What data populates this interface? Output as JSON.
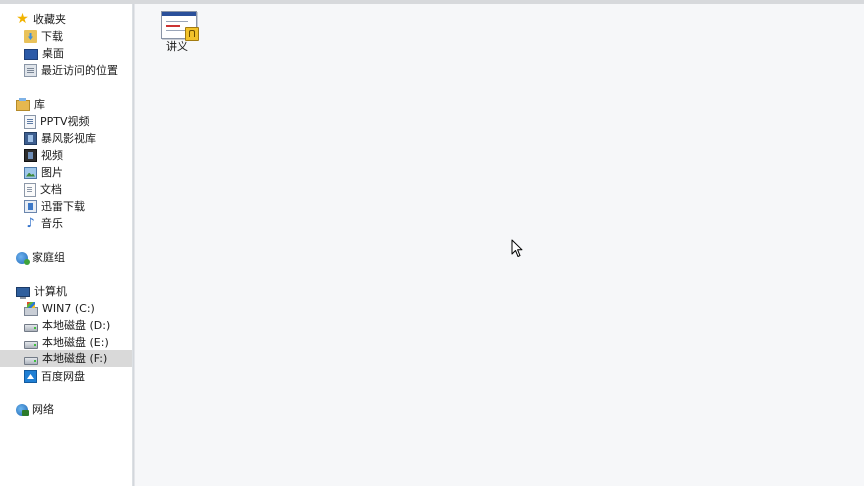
{
  "nav": {
    "favorites": {
      "label": "收藏夹",
      "items": [
        {
          "label": "下载",
          "icon": "download-folder-icon"
        },
        {
          "label": "桌面",
          "icon": "desktop-icon"
        },
        {
          "label": "最近访问的位置",
          "icon": "recent-places-icon"
        }
      ]
    },
    "libraries": {
      "label": "库",
      "items": [
        {
          "label": "PPTV视频",
          "icon": "pptv-library-icon"
        },
        {
          "label": "暴风影视库",
          "icon": "storm-library-icon"
        },
        {
          "label": "视频",
          "icon": "video-library-icon"
        },
        {
          "label": "图片",
          "icon": "pictures-library-icon"
        },
        {
          "label": "文档",
          "icon": "documents-library-icon"
        },
        {
          "label": "迅雷下载",
          "icon": "xunlei-download-icon"
        },
        {
          "label": "音乐",
          "icon": "music-library-icon"
        }
      ]
    },
    "homegroup": {
      "label": "家庭组",
      "icon": "homegroup-icon"
    },
    "computer": {
      "label": "计算机",
      "items": [
        {
          "label": "WIN7 (C:)",
          "icon": "windows-drive-icon"
        },
        {
          "label": "本地磁盘 (D:)",
          "icon": "local-disk-icon"
        },
        {
          "label": "本地磁盘 (E:)",
          "icon": "local-disk-icon"
        },
        {
          "label": "本地磁盘 (F:)",
          "icon": "local-disk-icon",
          "selected": true
        },
        {
          "label": "百度网盘",
          "icon": "baidu-netdisk-icon"
        }
      ]
    },
    "network": {
      "label": "网络",
      "icon": "network-icon"
    }
  },
  "content": {
    "files": [
      {
        "name": "讲义",
        "icon": "presentation-file-icon"
      }
    ]
  },
  "colors": {
    "selection": "#d9d9d9",
    "content_bg": "#f6f7f9",
    "nav_bg": "#ffffff"
  }
}
